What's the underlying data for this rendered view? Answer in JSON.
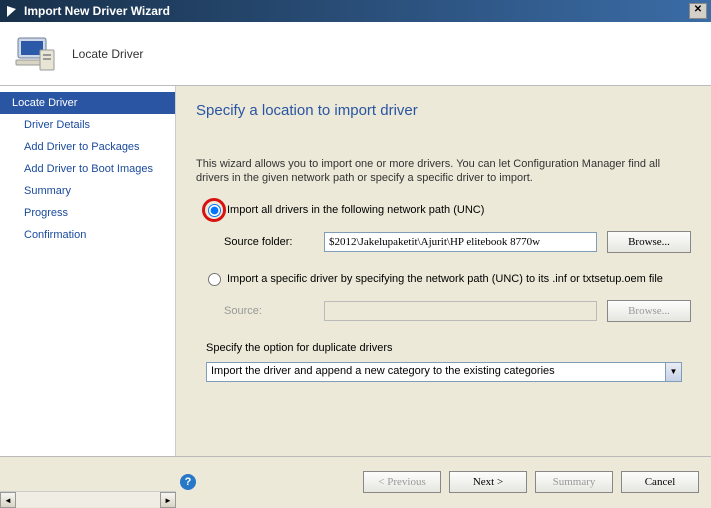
{
  "window": {
    "title": "Import New Driver Wizard"
  },
  "header": {
    "subtitle": "Locate Driver"
  },
  "sidebar": {
    "items": [
      {
        "label": "Locate Driver",
        "active": true
      },
      {
        "label": "Driver Details"
      },
      {
        "label": "Add Driver to Packages"
      },
      {
        "label": "Add Driver to Boot Images"
      },
      {
        "label": "Summary"
      },
      {
        "label": "Progress"
      },
      {
        "label": "Confirmation"
      }
    ]
  },
  "main": {
    "title": "Specify a location to import driver",
    "intro": "This wizard allows you to import one or more drivers. You can let Configuration Manager find all drivers in the given network path or specify a specific driver to import.",
    "opt1_label": "Import all drivers in the following network path (UNC)",
    "source_folder_label": "Source folder:",
    "source_folder_value": "$2012\\Jakelupaketit\\Ajurit\\HP elitebook 8770w",
    "browse1": "Browse...",
    "opt2_label": "Import a specific driver by specifying the network path (UNC) to its .inf or txtsetup.oem file",
    "source2_label": "Source:",
    "browse2": "Browse...",
    "dup_label": "Specify the option for duplicate drivers",
    "dup_option": "Import the driver and append a new category to the existing categories"
  },
  "footer": {
    "previous": "< Previous",
    "next": "Next >",
    "summary": "Summary",
    "cancel": "Cancel"
  }
}
